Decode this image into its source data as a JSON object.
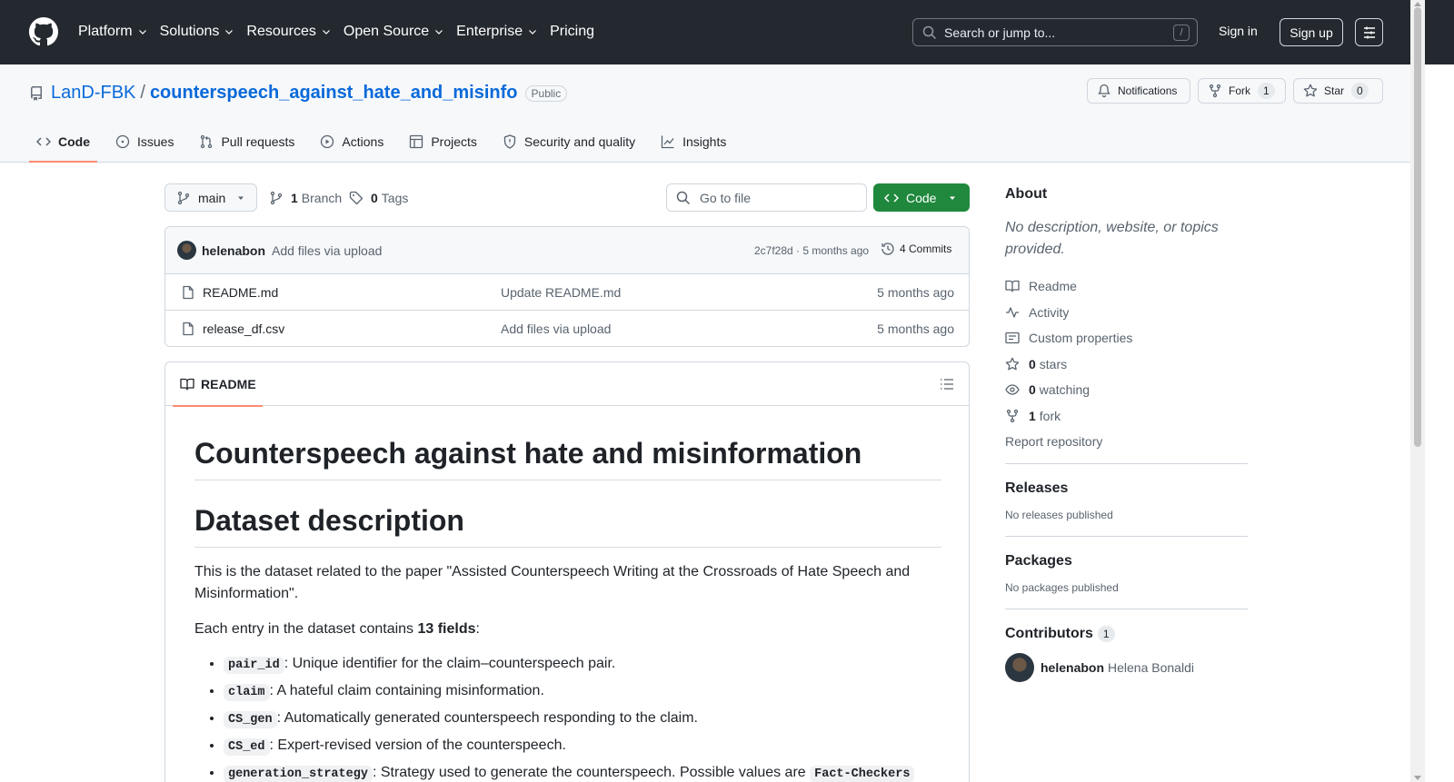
{
  "header": {
    "nav": [
      {
        "label": "Platform",
        "dropdown": true
      },
      {
        "label": "Solutions",
        "dropdown": true
      },
      {
        "label": "Resources",
        "dropdown": true
      },
      {
        "label": "Open Source",
        "dropdown": true
      },
      {
        "label": "Enterprise",
        "dropdown": true
      },
      {
        "label": "Pricing",
        "dropdown": false
      }
    ],
    "search_placeholder": "Search or jump to...",
    "search_shortcut": "/",
    "signin": "Sign in",
    "signup": "Sign up"
  },
  "repo": {
    "owner": "LanD-FBK",
    "separator": "/",
    "name": "counterspeech_against_hate_and_misinfo",
    "visibility": "Public",
    "notifications_label": "Notifications",
    "fork_label": "Fork",
    "fork_count": "1",
    "star_label": "Star",
    "star_count": "0",
    "tabs": [
      "Code",
      "Issues",
      "Pull requests",
      "Actions",
      "Projects",
      "Security and quality",
      "Insights"
    ],
    "active_tab": "Code"
  },
  "toolbar": {
    "branch": "main",
    "branch_count": "1",
    "branch_label": "Branch",
    "tag_count": "0",
    "tag_label": "Tags",
    "gofile_placeholder": "Go to file",
    "code_button": "Code"
  },
  "commit": {
    "author": "helenabon",
    "message": "Add files via upload",
    "hash_age": "2c7f28d · 5 months ago",
    "commits": "4 Commits"
  },
  "files": [
    {
      "name": "README.md",
      "message": "Update README.md",
      "age": "5 months ago"
    },
    {
      "name": "release_df.csv",
      "message": "Add files via upload",
      "age": "5 months ago"
    }
  ],
  "readme": {
    "tab": "README",
    "title": "Counterspeech against hate and misinformation",
    "section": "Dataset description",
    "intro": "This is the dataset related to the paper \"Assisted Counterspeech Writing at the Crossroads of Hate Speech and Misinformation\".",
    "entry_prefix": "Each entry in the dataset contains ",
    "entry_bold": "13 fields",
    "entry_suffix": ":",
    "fields": [
      {
        "code": "pair_id",
        "text": ": Unique identifier for the claim–counterspeech pair."
      },
      {
        "code": "claim",
        "text": ": A hateful claim containing misinformation."
      },
      {
        "code": "CS_gen",
        "text": ": Automatically generated counterspeech responding to the claim."
      },
      {
        "code": "CS_ed",
        "text": ": Expert-revised version of the counterspeech."
      },
      {
        "code": "generation_strategy",
        "text": ": Strategy used to generate the counterspeech. Possible values are ",
        "code2": "Fact-Checkers"
      }
    ]
  },
  "sidebar": {
    "about_title": "About",
    "about_desc": "No description, website, or topics provided.",
    "links": [
      {
        "icon": "book-icon",
        "bold": "",
        "label": "Readme"
      },
      {
        "icon": "pulse-icon",
        "bold": "",
        "label": "Activity"
      },
      {
        "icon": "note-icon",
        "bold": "",
        "label": "Custom properties"
      },
      {
        "icon": "star-icon",
        "bold": "0",
        "label": "stars"
      },
      {
        "icon": "eye-icon",
        "bold": "0",
        "label": "watching"
      },
      {
        "icon": "fork-icon",
        "bold": "1",
        "label": "fork"
      }
    ],
    "report": "Report repository",
    "releases_title": "Releases",
    "releases_sub": "No releases published",
    "packages_title": "Packages",
    "packages_sub": "No packages published",
    "contributors_title": "Contributors",
    "contributors_count": "1",
    "contributor_login": "helenabon",
    "contributor_name": "Helena Bonaldi"
  }
}
